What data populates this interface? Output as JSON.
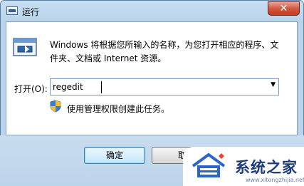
{
  "window": {
    "title": "运行",
    "close_label": "✕"
  },
  "content": {
    "description": "Windows 将根据您所输入的名称，为您打开相应的程序、文件夹、文档或 Internet 资源。",
    "open_label": "打开(O):",
    "open_value": "regedit",
    "admin_note": "使用管理权限创建此任务。"
  },
  "buttons": {
    "ok": "确定",
    "cancel": "取",
    "browse": ""
  },
  "watermark": {
    "brand": "系统之家",
    "url": "www.xitongzhijia.net"
  },
  "icons": {
    "app": "run-window-icon",
    "run": "run-program-icon",
    "shield": "uac-shield-icon",
    "dropdown": "chevron-down-icon",
    "logo": "house-logo-icon"
  },
  "colors": {
    "accent": "#3c7fb1",
    "frame": "#b9d3ea",
    "close": "#c23a23",
    "brand": "#1d3c77"
  }
}
